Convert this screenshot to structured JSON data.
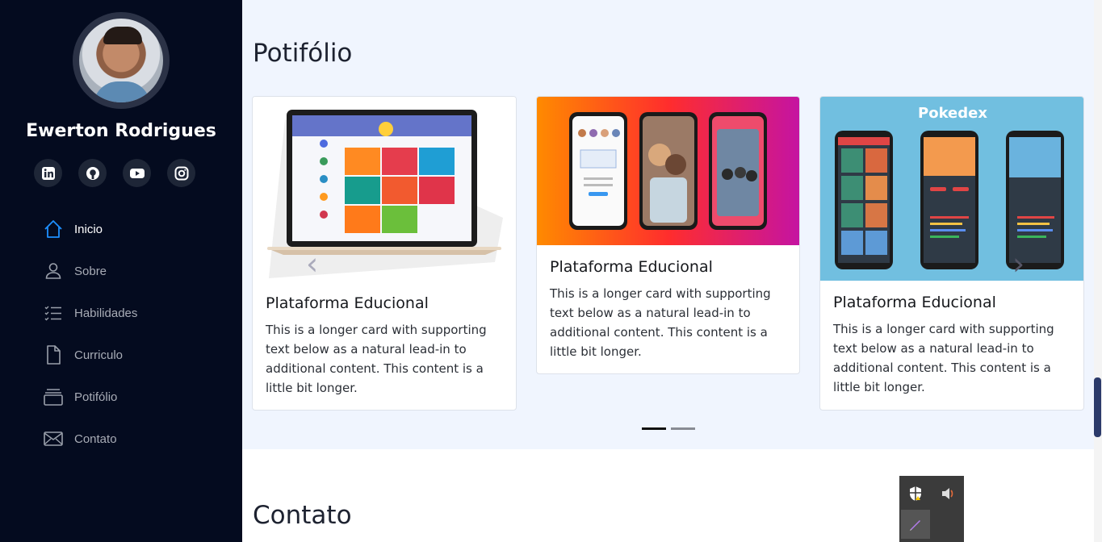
{
  "profile": {
    "name": "Ewerton Rodrigues"
  },
  "socials": [
    {
      "label": "in",
      "icon": "linkedin-icon"
    },
    {
      "label": "⌾",
      "icon": "github-icon"
    },
    {
      "label": "▶",
      "icon": "youtube-icon"
    },
    {
      "label": "◎",
      "icon": "instagram-icon"
    }
  ],
  "nav": {
    "items": [
      {
        "label": "Inicio",
        "icon": "home-icon",
        "active": true
      },
      {
        "label": "Sobre",
        "icon": "person-icon"
      },
      {
        "label": "Habilidades",
        "icon": "list-icon"
      },
      {
        "label": "Curriculo",
        "icon": "file-icon"
      },
      {
        "label": "Potifólio",
        "icon": "collection-icon"
      },
      {
        "label": "Contato",
        "icon": "envelope-icon"
      }
    ]
  },
  "portfolio": {
    "title": "Potifólio",
    "cards": [
      {
        "title": "Plataforma Educional",
        "text": "This is a longer card with supporting text below as a natural lead-in to additional content. This content is a little bit longer.",
        "image": "laptop-mockup"
      },
      {
        "title": "Plataforma Educional",
        "text": "This is a longer card with supporting text below as a natural lead-in to additional content. This content is a little bit longer.",
        "image": "instagram-phones"
      },
      {
        "title": "Plataforma Educional",
        "text": "This is a longer card with supporting text below as a natural lead-in to additional content. This content is a little bit longer.",
        "image": "pokedex-phones",
        "image_label": "Pokedex"
      }
    ],
    "carousel": {
      "prev": "‹",
      "next": "›",
      "slides": 2,
      "active": 0
    }
  },
  "contato": {
    "title": "Contato"
  },
  "colors": {
    "sidebar": "#040b1f",
    "section_bg": "#f0f5fe",
    "accent": "#1e90ff"
  }
}
